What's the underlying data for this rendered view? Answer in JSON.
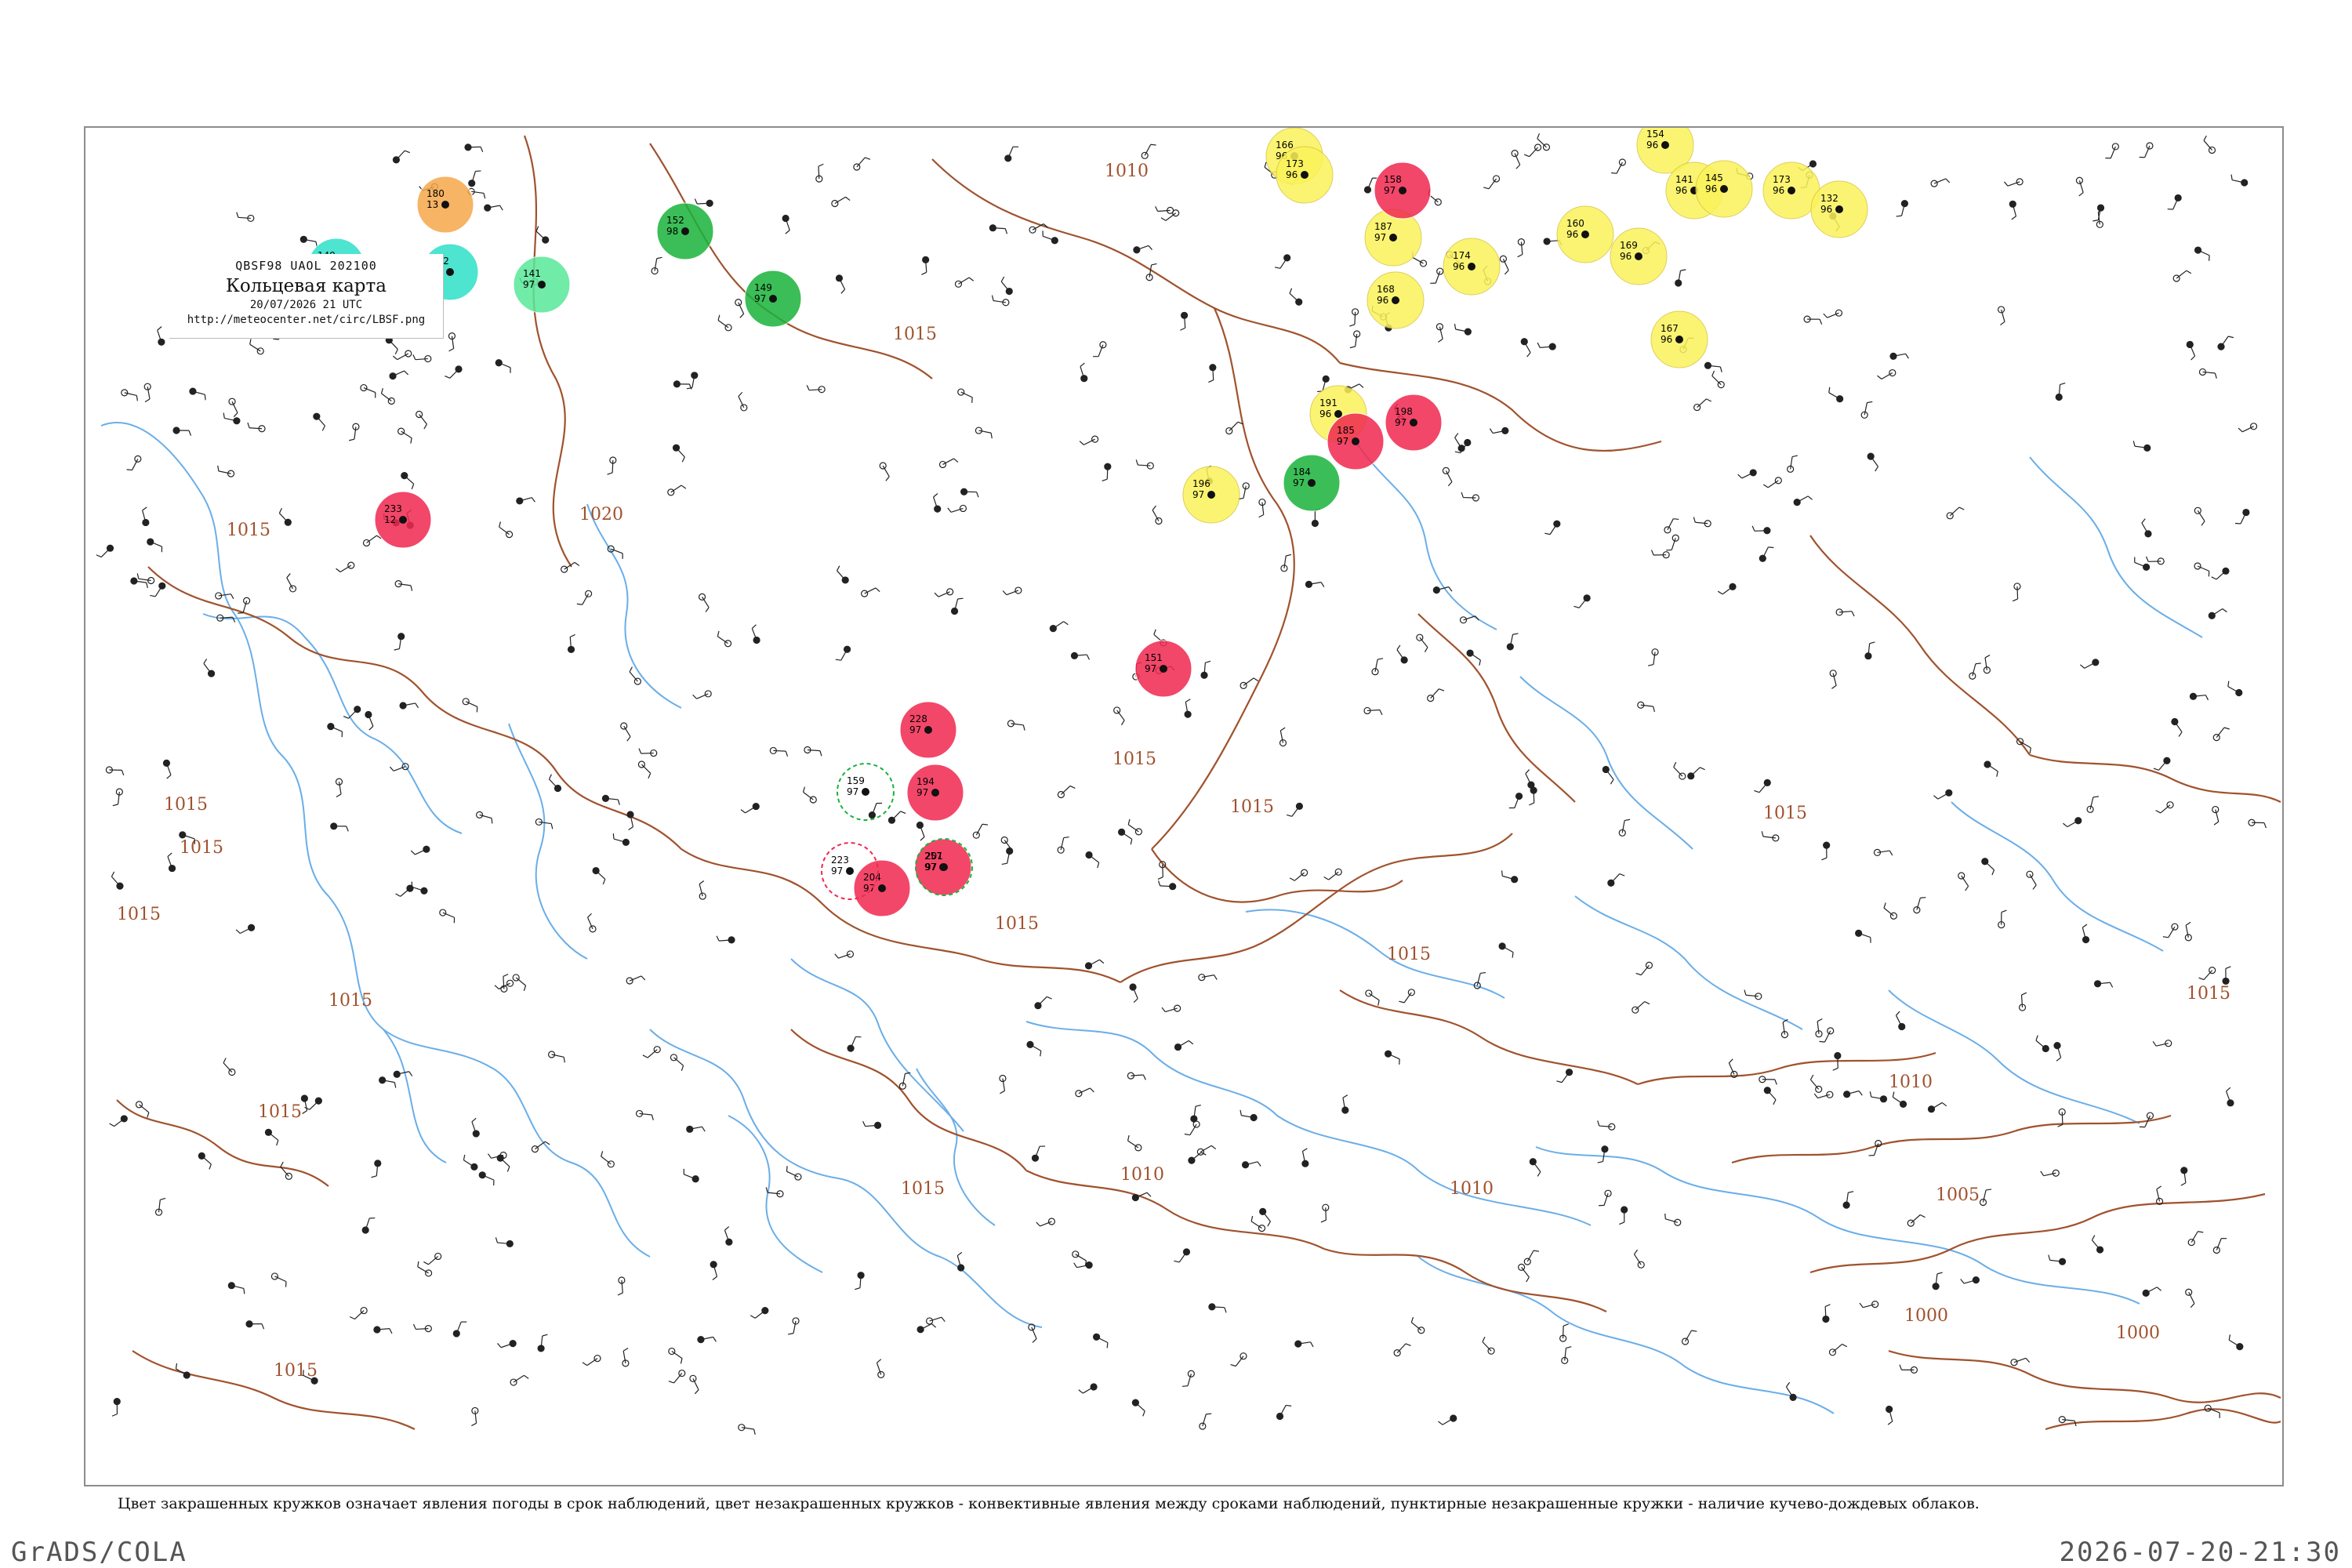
{
  "legend": {
    "ids": "QBSF98  UAOL  202100",
    "title": "Кольцевая карта",
    "datetime": "20/07/2026 21 UTC",
    "url": "http://meteocenter.net/circ/LBSF.png"
  },
  "caption": "Цвет закрашенных кружков означает явления погоды в срок наблюдений, цвет незакрашенных кружков - конвективные явления между сроками наблюдений, пунктирные незакрашенные кружки - наличие кучево-дождевых облаков.",
  "footer": {
    "left": "GrADS/COLA",
    "right": "2026-07-20-21:30"
  },
  "colors": {
    "isobar": "#a0522d",
    "coast": "#6aaee8",
    "red": "#f0284f",
    "yellow": "#fbf35a",
    "green": "#19b33a",
    "cyan": "#2fe0c8",
    "lightgreen": "#58e89a",
    "orange": "#f5a84a"
  },
  "isobar_labels": [
    "1010",
    "1015",
    "1015",
    "1015",
    "1015",
    "1015",
    "1015",
    "1015",
    "1015",
    "1015",
    "1015",
    "1015",
    "1015",
    "1015",
    "1010",
    "1010",
    "1010",
    "1005",
    "1000",
    "1000",
    "1015",
    "1020",
    "1015"
  ],
  "stations": [
    {
      "id": "s1",
      "t": "233",
      "p": "12",
      "kind": "red"
    },
    {
      "id": "s2",
      "t": "180",
      "p": "13",
      "kind": "orange"
    },
    {
      "id": "s3",
      "t": "149",
      "p": "97",
      "kind": "cyan"
    },
    {
      "id": "s4",
      "t": "142",
      "p": "97",
      "kind": "cyan"
    },
    {
      "id": "s5",
      "t": "141",
      "p": "97",
      "kind": "lightgreen"
    },
    {
      "id": "s6",
      "t": "152",
      "p": "98",
      "kind": "green"
    },
    {
      "id": "s7",
      "t": "149",
      "p": "97",
      "kind": "green"
    },
    {
      "id": "s8",
      "t": "166",
      "p": "96",
      "kind": "yellow"
    },
    {
      "id": "s9",
      "t": "173",
      "p": "96",
      "kind": "yellow"
    },
    {
      "id": "s10",
      "t": "187",
      "p": "97",
      "kind": "yellow"
    },
    {
      "id": "s11",
      "t": "168",
      "p": "96",
      "kind": "yellow"
    },
    {
      "id": "s12",
      "t": "158",
      "p": "97",
      "kind": "red"
    },
    {
      "id": "s13",
      "t": "174",
      "p": "96",
      "kind": "yellow"
    },
    {
      "id": "s14",
      "t": "154",
      "p": "96",
      "kind": "yellow"
    },
    {
      "id": "s15",
      "t": "141",
      "p": "96",
      "kind": "yellow"
    },
    {
      "id": "s16",
      "t": "145",
      "p": "96",
      "kind": "yellow"
    },
    {
      "id": "s17",
      "t": "160",
      "p": "96",
      "kind": "yellow"
    },
    {
      "id": "s18",
      "t": "169",
      "p": "96",
      "kind": "yellow"
    },
    {
      "id": "s19",
      "t": "167",
      "p": "96",
      "kind": "yellow"
    },
    {
      "id": "s20",
      "t": "173",
      "p": "96",
      "kind": "yellow"
    },
    {
      "id": "s21",
      "t": "132",
      "p": "96",
      "kind": "yellow"
    },
    {
      "id": "s22",
      "t": "191",
      "p": "96",
      "kind": "yellow"
    },
    {
      "id": "s23",
      "t": "185",
      "p": "97",
      "kind": "red"
    },
    {
      "id": "s24",
      "t": "198",
      "p": "97",
      "kind": "red"
    },
    {
      "id": "s25",
      "t": "184",
      "p": "97",
      "kind": "green"
    },
    {
      "id": "s26",
      "t": "196",
      "p": "97",
      "kind": "yellow"
    },
    {
      "id": "s27",
      "t": "151",
      "p": "97",
      "kind": "red"
    },
    {
      "id": "s28",
      "t": "228",
      "p": "97",
      "kind": "red"
    },
    {
      "id": "s29",
      "t": "194",
      "p": "97",
      "kind": "red"
    },
    {
      "id": "s30",
      "t": "204",
      "p": "97",
      "kind": "red"
    },
    {
      "id": "s31",
      "t": "257",
      "p": "97",
      "kind": "red"
    },
    {
      "id": "s32",
      "t": "159",
      "p": "97",
      "kind": "ring-green"
    },
    {
      "id": "s33",
      "t": "223",
      "p": "97",
      "kind": "ring-red"
    },
    {
      "id": "s34",
      "t": "201",
      "p": "97",
      "kind": "ring-green"
    }
  ]
}
